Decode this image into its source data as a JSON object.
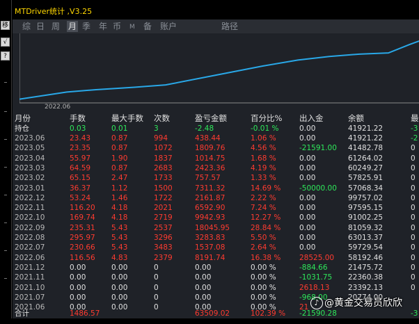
{
  "title": "MTDriver统计 ,V3.25",
  "left_buttons": [
    "移",
    "√",
    "?"
  ],
  "tabs": [
    {
      "label": "综",
      "active": false
    },
    {
      "label": "日",
      "active": false
    },
    {
      "label": "周",
      "active": false
    },
    {
      "label": "月",
      "active": true
    },
    {
      "label": "季",
      "active": false
    },
    {
      "label": "年",
      "active": false
    },
    {
      "label": "币",
      "active": false
    },
    {
      "label": "M",
      "active": false
    },
    {
      "label": "备",
      "active": false
    },
    {
      "label": "账户",
      "active": false
    },
    {
      "label": "路径",
      "active": false
    }
  ],
  "chart_data": {
    "type": "line",
    "x_tick_labels": [
      "2022.06"
    ],
    "series": [
      {
        "values": [
          0,
          3,
          4,
          5,
          6,
          10,
          14,
          16.5,
          18,
          19,
          19.5,
          23,
          24.5
        ]
      }
    ],
    "ylim": [
      -1,
      26
    ],
    "line_color": "#29a8e8"
  },
  "colors": {
    "red": "#ff3b30",
    "green": "#2ee85a",
    "white": "#e0e0e0",
    "gray": "#b8b8b8",
    "yellow": "#ffd700"
  },
  "table": {
    "headers": [
      "月份",
      "手数",
      "最大手数",
      "次数",
      "盈亏金额",
      "百分比%",
      "出入金",
      "余额",
      "最"
    ],
    "holding": {
      "label": "持仓",
      "cells": [
        {
          "text": "0.03",
          "c": "green"
        },
        {
          "text": "0.01",
          "c": "green"
        },
        {
          "text": "3",
          "c": "green"
        },
        {
          "text": "-2.48",
          "c": "green"
        },
        {
          "text": "-0.01 %",
          "c": "green"
        },
        {
          "text": "0.00",
          "c": "white"
        },
        {
          "text": "41921.22",
          "c": "white"
        },
        {
          "text": "-3",
          "c": "green"
        }
      ]
    },
    "rows": [
      {
        "m": "2023.06",
        "cells": [
          {
            "text": "23.43",
            "c": "red"
          },
          {
            "text": "0.87",
            "c": "red"
          },
          {
            "text": "994",
            "c": "red"
          },
          {
            "text": "438.44",
            "c": "red"
          },
          {
            "text": "1.06 %",
            "c": "red"
          },
          {
            "text": "0.00",
            "c": "white"
          },
          {
            "text": "41921.22",
            "c": "white"
          },
          {
            "text": "-2",
            "c": "green"
          }
        ]
      },
      {
        "m": "2023.05",
        "cells": [
          {
            "text": "23.35",
            "c": "red"
          },
          {
            "text": "0.87",
            "c": "red"
          },
          {
            "text": "1072",
            "c": "red"
          },
          {
            "text": "1809.76",
            "c": "red"
          },
          {
            "text": "4.56 %",
            "c": "red"
          },
          {
            "text": "-21591.00",
            "c": "green"
          },
          {
            "text": "41482.78",
            "c": "white"
          },
          {
            "text": "0",
            "c": "white"
          }
        ]
      },
      {
        "m": "2023.04",
        "cells": [
          {
            "text": "55.97",
            "c": "red"
          },
          {
            "text": "1.90",
            "c": "red"
          },
          {
            "text": "1837",
            "c": "red"
          },
          {
            "text": "1014.75",
            "c": "red"
          },
          {
            "text": "1.68 %",
            "c": "red"
          },
          {
            "text": "0.00",
            "c": "white"
          },
          {
            "text": "61264.02",
            "c": "white"
          },
          {
            "text": "0",
            "c": "white"
          }
        ]
      },
      {
        "m": "2023.03",
        "cells": [
          {
            "text": "64.59",
            "c": "red"
          },
          {
            "text": "0.87",
            "c": "red"
          },
          {
            "text": "2683",
            "c": "red"
          },
          {
            "text": "2423.36",
            "c": "red"
          },
          {
            "text": "4.19 %",
            "c": "red"
          },
          {
            "text": "0.00",
            "c": "white"
          },
          {
            "text": "60249.27",
            "c": "white"
          },
          {
            "text": "0",
            "c": "white"
          }
        ]
      },
      {
        "m": "2023.02",
        "cells": [
          {
            "text": "65.15",
            "c": "red"
          },
          {
            "text": "2.47",
            "c": "red"
          },
          {
            "text": "1733",
            "c": "red"
          },
          {
            "text": "757.57",
            "c": "red"
          },
          {
            "text": "1.33 %",
            "c": "red"
          },
          {
            "text": "0.00",
            "c": "white"
          },
          {
            "text": "57825.91",
            "c": "white"
          },
          {
            "text": "0",
            "c": "white"
          }
        ]
      },
      {
        "m": "2023.01",
        "cells": [
          {
            "text": "36.37",
            "c": "red"
          },
          {
            "text": "1.12",
            "c": "red"
          },
          {
            "text": "1500",
            "c": "red"
          },
          {
            "text": "7311.32",
            "c": "red"
          },
          {
            "text": "14.69 %",
            "c": "red"
          },
          {
            "text": "-50000.00",
            "c": "green"
          },
          {
            "text": "57068.34",
            "c": "white"
          },
          {
            "text": "0",
            "c": "white"
          }
        ]
      },
      {
        "m": "2022.12",
        "cells": [
          {
            "text": "53.24",
            "c": "red"
          },
          {
            "text": "1.46",
            "c": "red"
          },
          {
            "text": "1722",
            "c": "red"
          },
          {
            "text": "2161.87",
            "c": "red"
          },
          {
            "text": "2.22 %",
            "c": "red"
          },
          {
            "text": "0.00",
            "c": "white"
          },
          {
            "text": "99757.02",
            "c": "white"
          },
          {
            "text": "0",
            "c": "white"
          }
        ]
      },
      {
        "m": "2022.11",
        "cells": [
          {
            "text": "116.20",
            "c": "red"
          },
          {
            "text": "4.18",
            "c": "red"
          },
          {
            "text": "2021",
            "c": "red"
          },
          {
            "text": "6592.90",
            "c": "red"
          },
          {
            "text": "7.24 %",
            "c": "red"
          },
          {
            "text": "0.00",
            "c": "white"
          },
          {
            "text": "97595.15",
            "c": "white"
          },
          {
            "text": "0",
            "c": "white"
          }
        ]
      },
      {
        "m": "2022.10",
        "cells": [
          {
            "text": "169.74",
            "c": "red"
          },
          {
            "text": "4.18",
            "c": "red"
          },
          {
            "text": "2719",
            "c": "red"
          },
          {
            "text": "9942.93",
            "c": "red"
          },
          {
            "text": "12.27 %",
            "c": "red"
          },
          {
            "text": "0.00",
            "c": "white"
          },
          {
            "text": "91002.25",
            "c": "white"
          },
          {
            "text": "0",
            "c": "white"
          }
        ]
      },
      {
        "m": "2022.09",
        "cells": [
          {
            "text": "235.31",
            "c": "red"
          },
          {
            "text": "5.43",
            "c": "red"
          },
          {
            "text": "2537",
            "c": "red"
          },
          {
            "text": "18045.95",
            "c": "red"
          },
          {
            "text": "28.84 %",
            "c": "red"
          },
          {
            "text": "0.00",
            "c": "white"
          },
          {
            "text": "81059.32",
            "c": "white"
          },
          {
            "text": "0",
            "c": "white"
          }
        ]
      },
      {
        "m": "2022.08",
        "cells": [
          {
            "text": "295.97",
            "c": "red"
          },
          {
            "text": "5.43",
            "c": "red"
          },
          {
            "text": "3296",
            "c": "red"
          },
          {
            "text": "3283.83",
            "c": "red"
          },
          {
            "text": "5.50 %",
            "c": "red"
          },
          {
            "text": "0.00",
            "c": "white"
          },
          {
            "text": "63013.37",
            "c": "white"
          },
          {
            "text": "0",
            "c": "white"
          }
        ]
      },
      {
        "m": "2022.07",
        "cells": [
          {
            "text": "230.66",
            "c": "red"
          },
          {
            "text": "5.43",
            "c": "red"
          },
          {
            "text": "3483",
            "c": "red"
          },
          {
            "text": "1537.08",
            "c": "red"
          },
          {
            "text": "2.64 %",
            "c": "red"
          },
          {
            "text": "0.00",
            "c": "white"
          },
          {
            "text": "59729.54",
            "c": "white"
          },
          {
            "text": "0",
            "c": "white"
          }
        ]
      },
      {
        "m": "2022.06",
        "cells": [
          {
            "text": "116.56",
            "c": "red"
          },
          {
            "text": "4.83",
            "c": "red"
          },
          {
            "text": "2379",
            "c": "red"
          },
          {
            "text": "8191.74",
            "c": "red"
          },
          {
            "text": "16.38 %",
            "c": "red"
          },
          {
            "text": "28525.00",
            "c": "red"
          },
          {
            "text": "58192.46",
            "c": "white"
          },
          {
            "text": "0",
            "c": "white"
          }
        ]
      },
      {
        "m": "2021.12",
        "cells": [
          {
            "text": "0.00",
            "c": "white"
          },
          {
            "text": "0.00",
            "c": "white"
          },
          {
            "text": "0",
            "c": "white"
          },
          {
            "text": "0.00",
            "c": "white"
          },
          {
            "text": "0.00 %",
            "c": "white"
          },
          {
            "text": "-884.66",
            "c": "green"
          },
          {
            "text": "21475.72",
            "c": "white"
          },
          {
            "text": "0",
            "c": "white"
          }
        ]
      },
      {
        "m": "2021.11",
        "cells": [
          {
            "text": "0.00",
            "c": "white"
          },
          {
            "text": "0.00",
            "c": "white"
          },
          {
            "text": "0",
            "c": "white"
          },
          {
            "text": "0.00",
            "c": "white"
          },
          {
            "text": "0.00 %",
            "c": "white"
          },
          {
            "text": "-1031.75",
            "c": "green"
          },
          {
            "text": "22360.38",
            "c": "white"
          },
          {
            "text": "0",
            "c": "white"
          }
        ]
      },
      {
        "m": "2021.10",
        "cells": [
          {
            "text": "0.00",
            "c": "white"
          },
          {
            "text": "0.00",
            "c": "white"
          },
          {
            "text": "0",
            "c": "white"
          },
          {
            "text": "0.00",
            "c": "white"
          },
          {
            "text": "0.00 %",
            "c": "white"
          },
          {
            "text": "2618.13",
            "c": "red"
          },
          {
            "text": "23392.13",
            "c": "white"
          },
          {
            "text": "0",
            "c": "white"
          }
        ]
      },
      {
        "m": "2021.07",
        "cells": [
          {
            "text": "0.00",
            "c": "white"
          },
          {
            "text": "0.00",
            "c": "white"
          },
          {
            "text": "0",
            "c": "white"
          },
          {
            "text": "0.00",
            "c": "white"
          },
          {
            "text": "0.00 %",
            "c": "white"
          },
          {
            "text": "-968.00",
            "c": "green"
          },
          {
            "text": "20774.00",
            "c": "white"
          },
          {
            "text": "",
            "c": "white"
          }
        ]
      },
      {
        "m": "2021.06",
        "cells": [
          {
            "text": "0.00",
            "c": "white"
          },
          {
            "text": "0.00",
            "c": "white"
          },
          {
            "text": "0",
            "c": "white"
          },
          {
            "text": "0.00",
            "c": "white"
          },
          {
            "text": "0.00 %",
            "c": "white"
          },
          {
            "text": "21",
            "c": "red"
          },
          {
            "text": "",
            "c": "white"
          },
          {
            "text": "",
            "c": "white"
          }
        ]
      }
    ],
    "total": {
      "label": "合计",
      "cells": [
        {
          "text": "1486.57",
          "c": "red"
        },
        {
          "text": "",
          "c": "white"
        },
        {
          "text": "",
          "c": "white"
        },
        {
          "text": "63509.02",
          "c": "red"
        },
        {
          "text": "102.39 %",
          "c": "red"
        },
        {
          "text": "-21590.28",
          "c": "green"
        },
        {
          "text": "",
          "c": "white"
        },
        {
          "text": "-3",
          "c": "green"
        }
      ]
    }
  },
  "watermark": "@黄金交易员欣欣",
  "watermark_icon": "douyin-logo-icon"
}
